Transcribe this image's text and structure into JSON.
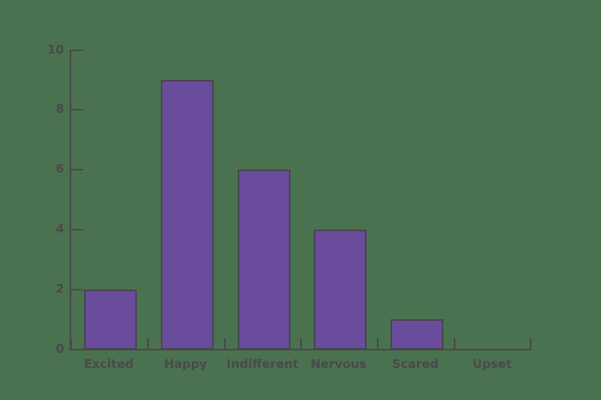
{
  "chart_data": {
    "type": "bar",
    "title": "",
    "subtitle": "",
    "xlabel": "",
    "ylabel": "",
    "categories": [
      "Excited",
      "Happy",
      "Indifferent",
      "Nervous",
      "Scared",
      "Upset"
    ],
    "values": [
      2,
      9,
      6,
      4,
      1,
      0
    ],
    "ylim": [
      0,
      10
    ],
    "ytick_labels": [
      "0",
      "2",
      "4",
      "6",
      "8",
      "10"
    ],
    "ytick_values": [
      0,
      2,
      4,
      6,
      8,
      10
    ],
    "grid": false,
    "legend": false,
    "legend_position": "none",
    "colors": {
      "background": "#4a7250",
      "bar_fill": "#6a4c9c",
      "bar_edge": "#4a4550",
      "axis": "#4a4a4a",
      "tick_text": "#4a4a4a"
    }
  }
}
